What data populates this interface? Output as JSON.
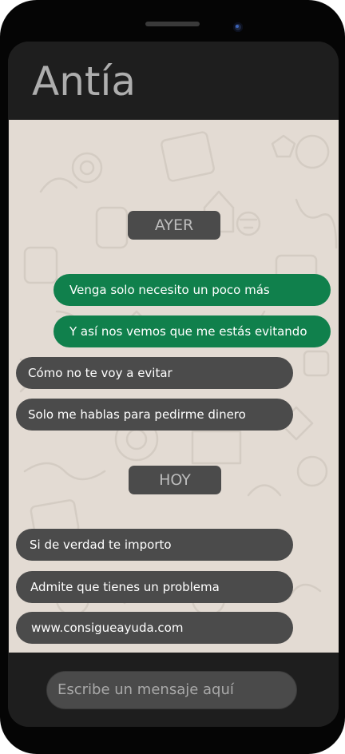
{
  "contact": {
    "name": "Antía"
  },
  "chat": {
    "day_separators": [
      "AYER",
      "HOY"
    ],
    "messages_yesterday": [
      {
        "direction": "outgoing",
        "text": "Venga solo necesito un poco más"
      },
      {
        "direction": "outgoing",
        "text": "Y así nos vemos que me estás evitando"
      },
      {
        "direction": "incoming",
        "text": "Cómo no te voy a evitar"
      },
      {
        "direction": "incoming",
        "text": "Solo me hablas para pedirme dinero"
      }
    ],
    "messages_today": [
      {
        "direction": "incoming",
        "text": "Si de verdad te importo"
      },
      {
        "direction": "incoming",
        "text": "Admite que tienes un problema"
      },
      {
        "direction": "incoming",
        "text": "www.consigueayuda.com"
      }
    ]
  },
  "composer": {
    "placeholder": "Escribe un mensaje aquí"
  },
  "colors": {
    "header": "#1e1e1e",
    "chat_background": "#e3dbd3",
    "outgoing_bubble": "#10804c",
    "incoming_bubble": "#4b4b4b"
  }
}
